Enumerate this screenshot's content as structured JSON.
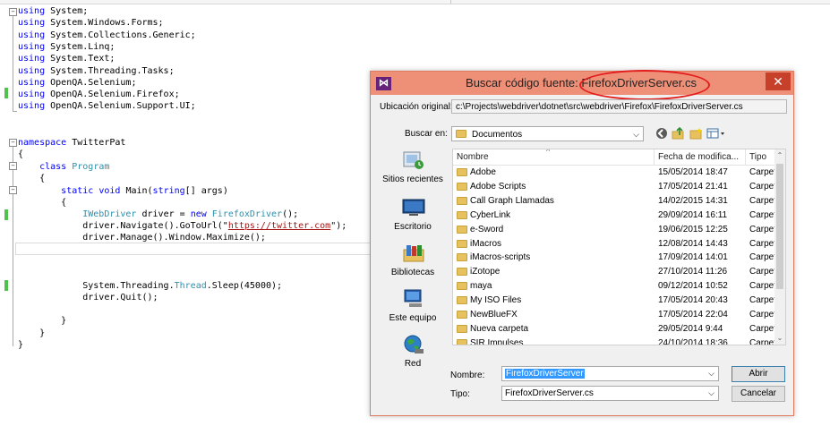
{
  "editor": {
    "lines": [
      {
        "kw": "using",
        "rest": " System;"
      },
      {
        "kw": "using",
        "rest": " System.Windows.Forms;"
      },
      {
        "kw": "using",
        "rest": " System.Collections.Generic;"
      },
      {
        "kw": "using",
        "rest": " System.Linq;"
      },
      {
        "kw": "using",
        "rest": " System.Text;"
      },
      {
        "kw": "using",
        "rest": " System.Threading.Tasks;"
      },
      {
        "kw": "using",
        "rest": " OpenQA.Selenium;"
      },
      {
        "kw": "using",
        "rest": " OpenQA.Selenium.Firefox;"
      },
      {
        "kw": "using",
        "rest": " OpenQA.Selenium.Support.UI;"
      }
    ],
    "ns_kw": "namespace",
    "ns_name": " TwitterPat",
    "brace_open": "{",
    "brace_close": "}",
    "class_kw": "class",
    "class_name": "Program",
    "static_kw": "static",
    "void_kw": "void",
    "main_sig": " Main(",
    "string_kw": "string",
    "main_args": "[] args)",
    "iwebdriver": "IWebDriver",
    "driver_assign": " driver = ",
    "new_kw": "new",
    "firefoxdriver": "FirefoxDriver",
    "ctor_end": "();",
    "navigate_pre": "driver.Navigate().GoToUrl(\"",
    "url": "https://twitter.com",
    "navigate_post": "\");",
    "manage": "driver.Manage().Window.Maximize();",
    "sleep_pre": "System.Threading.",
    "thread": "Thread",
    "sleep_post": ".Sleep(45000);",
    "quit": "driver.Quit();"
  },
  "dialog": {
    "title_prefix": "Buscar código fuente: ",
    "title_file": "FirefoxDriverServer.cs",
    "close_glyph": "✕",
    "logo_glyph": "⋈",
    "orig_label": "Ubicación original:",
    "orig_path": "c:\\Projects\\webdriver\\dotnet\\src\\webdriver\\Firefox\\FirefoxDriverServer.cs",
    "lookin_label": "Buscar en:",
    "lookin_value": "Documentos",
    "places": [
      "Sitios recientes",
      "Escritorio",
      "Bibliotecas",
      "Este equipo",
      "Red"
    ],
    "columns": {
      "name": "Nombre",
      "date": "Fecha de modifica...",
      "type": "Tipo"
    },
    "files": [
      {
        "name": "Adobe",
        "date": "15/05/2014 18:47",
        "type": "Carpet"
      },
      {
        "name": "Adobe Scripts",
        "date": "17/05/2014 21:41",
        "type": "Carpet"
      },
      {
        "name": "Call Graph Llamadas",
        "date": "14/02/2015 14:31",
        "type": "Carpet"
      },
      {
        "name": "CyberLink",
        "date": "29/09/2014 16:11",
        "type": "Carpet"
      },
      {
        "name": "e-Sword",
        "date": "19/06/2015 12:25",
        "type": "Carpet"
      },
      {
        "name": "iMacros",
        "date": "12/08/2014 14:43",
        "type": "Carpet"
      },
      {
        "name": "iMacros-scripts",
        "date": "17/09/2014 14:01",
        "type": "Carpet"
      },
      {
        "name": "iZotope",
        "date": "27/10/2014 11:26",
        "type": "Carpet"
      },
      {
        "name": "maya",
        "date": "09/12/2014 10:52",
        "type": "Carpet"
      },
      {
        "name": "My ISO Files",
        "date": "17/05/2014 20:43",
        "type": "Carpet"
      },
      {
        "name": "NewBlueFX",
        "date": "17/05/2014 22:04",
        "type": "Carpet"
      },
      {
        "name": "Nueva carpeta",
        "date": "29/05/2014 9:44",
        "type": "Carpet"
      },
      {
        "name": "SIR Impulses",
        "date": "24/10/2014 18:36",
        "type": "Carpet"
      }
    ],
    "filename_label": "Nombre:",
    "filename_value": "FirefoxDriverServer",
    "filetype_label": "Tipo:",
    "filetype_value": "FirefoxDriverServer.cs",
    "open_btn": "Abrir",
    "cancel_btn": "Cancelar",
    "sort_glyph": "^",
    "dropdown_glyph": "⌵",
    "scroll_up": "⌃",
    "scroll_down": "⌄"
  }
}
